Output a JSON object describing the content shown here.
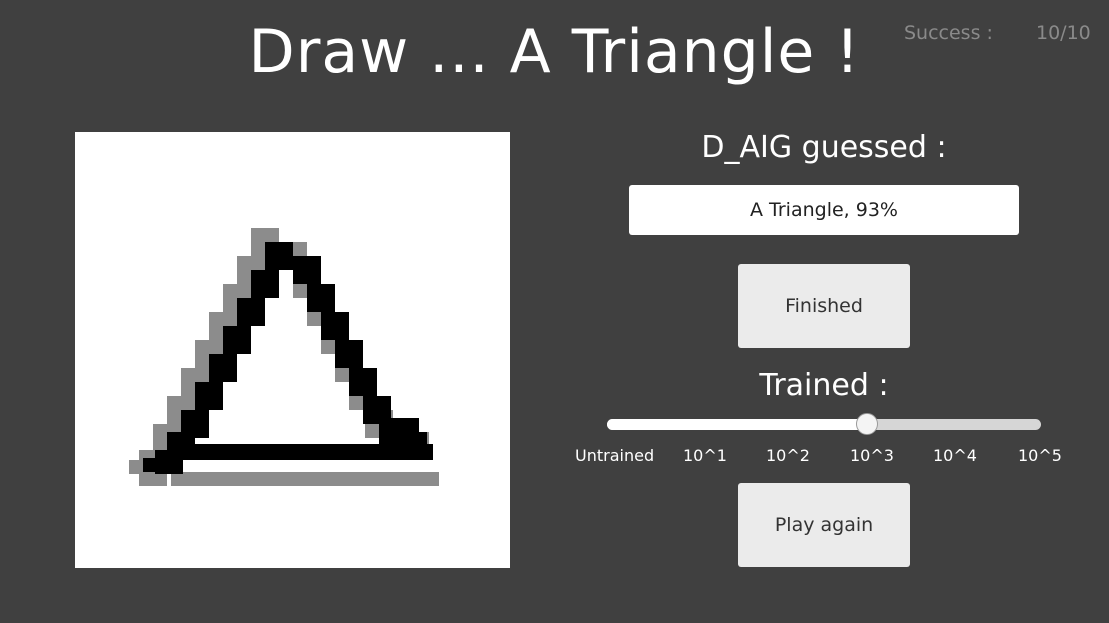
{
  "header": {
    "title": "Draw ... A Triangle !",
    "success_label": "Success :",
    "success_value": "10/10"
  },
  "guess": {
    "label": "D_AIG guessed :",
    "value": "A Triangle, 93%"
  },
  "buttons": {
    "finished": "Finished",
    "play_again": "Play again"
  },
  "training": {
    "label": "Trained :",
    "ticks": [
      "Untrained",
      "10^1",
      "10^2",
      "10^3",
      "10^4",
      "10^5"
    ],
    "selected": "10^3",
    "fraction": 0.6
  },
  "colors": {
    "background": "#404040",
    "stroke": "#000000",
    "stroke_shadow": "#8c8c8c"
  }
}
